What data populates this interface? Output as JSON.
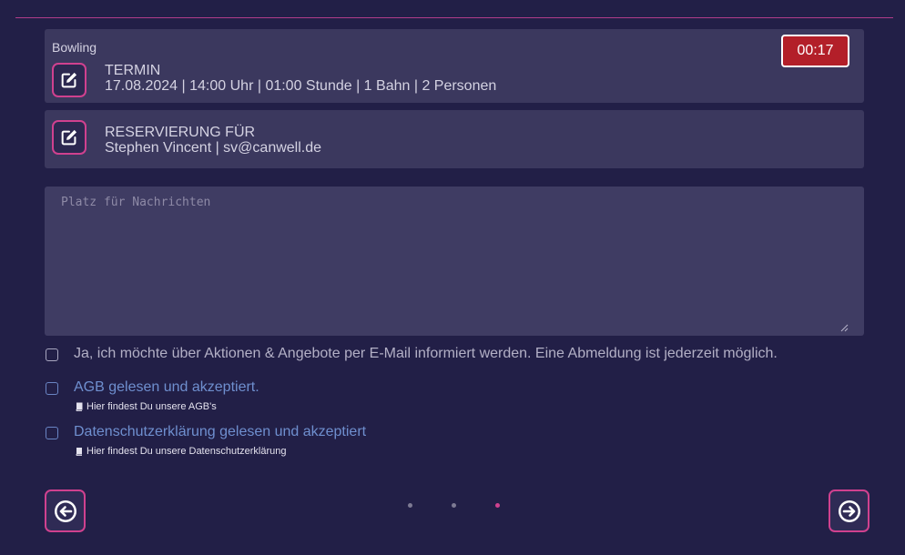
{
  "booking": {
    "category": "Bowling",
    "timer": "00:17",
    "termin": {
      "title": "TERMIN",
      "details": "17.08.2024 | 14:00 Uhr | 01:00 Stunde | 1 Bahn | 2 Personen"
    },
    "reservation": {
      "title": "RESERVIERUNG FÜR",
      "details": "Stephen Vincent | sv@canwell.de"
    }
  },
  "message": {
    "placeholder": "Platz für Nachrichten",
    "value": ""
  },
  "consents": {
    "newsletter": {
      "label": "Ja, ich möchte über Aktionen & Angebote per E-Mail informiert werden. Eine Abmeldung ist jederzeit möglich.",
      "checked": false
    },
    "agb": {
      "label": "AGB gelesen und akzeptiert.",
      "link": "Hier findest Du unsere AGB's",
      "checked": false
    },
    "privacy": {
      "label": "Datenschutzerklärung gelesen und akzeptiert",
      "link": "Hier findest Du unsere Datenschutzerklärung",
      "checked": false
    }
  },
  "pagination": {
    "total": 3,
    "current": 3
  },
  "icons": {
    "edit": "edit-icon",
    "book": "book-icon",
    "prev": "arrow-left-circle-icon",
    "next": "arrow-right-circle-icon"
  },
  "colors": {
    "background": "#221f47",
    "card": "#3b385e",
    "accent": "#d0418f",
    "timer": "#b31f29",
    "link": "#6f8fcf"
  }
}
